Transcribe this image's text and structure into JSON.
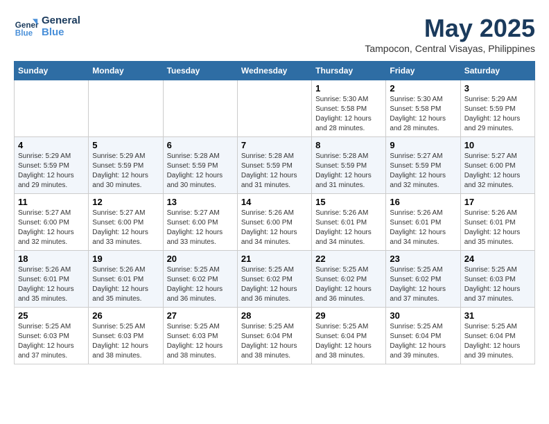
{
  "logo": {
    "line1": "General",
    "line2": "Blue"
  },
  "title": "May 2025",
  "location": "Tampocon, Central Visayas, Philippines",
  "weekdays": [
    "Sunday",
    "Monday",
    "Tuesday",
    "Wednesday",
    "Thursday",
    "Friday",
    "Saturday"
  ],
  "weeks": [
    [
      {
        "day": "",
        "info": ""
      },
      {
        "day": "",
        "info": ""
      },
      {
        "day": "",
        "info": ""
      },
      {
        "day": "",
        "info": ""
      },
      {
        "day": "1",
        "info": "Sunrise: 5:30 AM\nSunset: 5:58 PM\nDaylight: 12 hours\nand 28 minutes."
      },
      {
        "day": "2",
        "info": "Sunrise: 5:30 AM\nSunset: 5:58 PM\nDaylight: 12 hours\nand 28 minutes."
      },
      {
        "day": "3",
        "info": "Sunrise: 5:29 AM\nSunset: 5:59 PM\nDaylight: 12 hours\nand 29 minutes."
      }
    ],
    [
      {
        "day": "4",
        "info": "Sunrise: 5:29 AM\nSunset: 5:59 PM\nDaylight: 12 hours\nand 29 minutes."
      },
      {
        "day": "5",
        "info": "Sunrise: 5:29 AM\nSunset: 5:59 PM\nDaylight: 12 hours\nand 30 minutes."
      },
      {
        "day": "6",
        "info": "Sunrise: 5:28 AM\nSunset: 5:59 PM\nDaylight: 12 hours\nand 30 minutes."
      },
      {
        "day": "7",
        "info": "Sunrise: 5:28 AM\nSunset: 5:59 PM\nDaylight: 12 hours\nand 31 minutes."
      },
      {
        "day": "8",
        "info": "Sunrise: 5:28 AM\nSunset: 5:59 PM\nDaylight: 12 hours\nand 31 minutes."
      },
      {
        "day": "9",
        "info": "Sunrise: 5:27 AM\nSunset: 5:59 PM\nDaylight: 12 hours\nand 32 minutes."
      },
      {
        "day": "10",
        "info": "Sunrise: 5:27 AM\nSunset: 6:00 PM\nDaylight: 12 hours\nand 32 minutes."
      }
    ],
    [
      {
        "day": "11",
        "info": "Sunrise: 5:27 AM\nSunset: 6:00 PM\nDaylight: 12 hours\nand 32 minutes."
      },
      {
        "day": "12",
        "info": "Sunrise: 5:27 AM\nSunset: 6:00 PM\nDaylight: 12 hours\nand 33 minutes."
      },
      {
        "day": "13",
        "info": "Sunrise: 5:27 AM\nSunset: 6:00 PM\nDaylight: 12 hours\nand 33 minutes."
      },
      {
        "day": "14",
        "info": "Sunrise: 5:26 AM\nSunset: 6:00 PM\nDaylight: 12 hours\nand 34 minutes."
      },
      {
        "day": "15",
        "info": "Sunrise: 5:26 AM\nSunset: 6:01 PM\nDaylight: 12 hours\nand 34 minutes."
      },
      {
        "day": "16",
        "info": "Sunrise: 5:26 AM\nSunset: 6:01 PM\nDaylight: 12 hours\nand 34 minutes."
      },
      {
        "day": "17",
        "info": "Sunrise: 5:26 AM\nSunset: 6:01 PM\nDaylight: 12 hours\nand 35 minutes."
      }
    ],
    [
      {
        "day": "18",
        "info": "Sunrise: 5:26 AM\nSunset: 6:01 PM\nDaylight: 12 hours\nand 35 minutes."
      },
      {
        "day": "19",
        "info": "Sunrise: 5:26 AM\nSunset: 6:01 PM\nDaylight: 12 hours\nand 35 minutes."
      },
      {
        "day": "20",
        "info": "Sunrise: 5:25 AM\nSunset: 6:02 PM\nDaylight: 12 hours\nand 36 minutes."
      },
      {
        "day": "21",
        "info": "Sunrise: 5:25 AM\nSunset: 6:02 PM\nDaylight: 12 hours\nand 36 minutes."
      },
      {
        "day": "22",
        "info": "Sunrise: 5:25 AM\nSunset: 6:02 PM\nDaylight: 12 hours\nand 36 minutes."
      },
      {
        "day": "23",
        "info": "Sunrise: 5:25 AM\nSunset: 6:02 PM\nDaylight: 12 hours\nand 37 minutes."
      },
      {
        "day": "24",
        "info": "Sunrise: 5:25 AM\nSunset: 6:03 PM\nDaylight: 12 hours\nand 37 minutes."
      }
    ],
    [
      {
        "day": "25",
        "info": "Sunrise: 5:25 AM\nSunset: 6:03 PM\nDaylight: 12 hours\nand 37 minutes."
      },
      {
        "day": "26",
        "info": "Sunrise: 5:25 AM\nSunset: 6:03 PM\nDaylight: 12 hours\nand 38 minutes."
      },
      {
        "day": "27",
        "info": "Sunrise: 5:25 AM\nSunset: 6:03 PM\nDaylight: 12 hours\nand 38 minutes."
      },
      {
        "day": "28",
        "info": "Sunrise: 5:25 AM\nSunset: 6:04 PM\nDaylight: 12 hours\nand 38 minutes."
      },
      {
        "day": "29",
        "info": "Sunrise: 5:25 AM\nSunset: 6:04 PM\nDaylight: 12 hours\nand 38 minutes."
      },
      {
        "day": "30",
        "info": "Sunrise: 5:25 AM\nSunset: 6:04 PM\nDaylight: 12 hours\nand 39 minutes."
      },
      {
        "day": "31",
        "info": "Sunrise: 5:25 AM\nSunset: 6:04 PM\nDaylight: 12 hours\nand 39 minutes."
      }
    ]
  ]
}
